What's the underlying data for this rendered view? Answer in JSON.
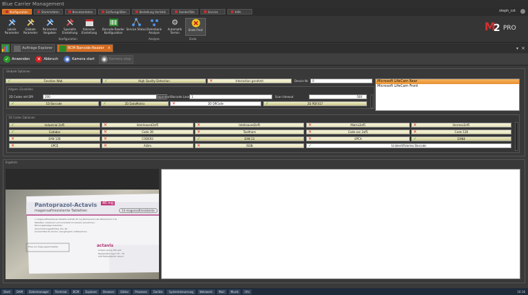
{
  "app": {
    "title": "Blue Carrier Management"
  },
  "ribbon_tabs": [
    {
      "label": "Konfiguration",
      "active": true
    },
    {
      "label": "Stammdaten",
      "active": false
    },
    {
      "label": "Benutzerdaten",
      "active": false
    },
    {
      "label": "Einflussgrößen",
      "active": false
    },
    {
      "label": "Bestellung Vorlistik",
      "active": false
    },
    {
      "label": "Sonderfälle",
      "active": false
    },
    {
      "label": "Service",
      "active": false
    },
    {
      "label": "Hilfe",
      "active": false
    }
  ],
  "user": {
    "name": "steph_cst"
  },
  "ribbon": {
    "buttons": [
      {
        "label": "Lokale Parameter",
        "icon": "tools-icon"
      },
      {
        "label": "Globale Parameter",
        "icon": "tools-icon"
      },
      {
        "label": "Parameter Vorgaben",
        "icon": "tools-icon"
      },
      {
        "label": "Spezielle Einstellung",
        "icon": "tools-icon"
      },
      {
        "label": "Kalender Einstellung",
        "icon": "calendar-icon"
      },
      {
        "label": "Barcode-Reader Konfiguration",
        "icon": "barcode-icon"
      },
      {
        "label": "Service Status",
        "icon": "network-icon"
      },
      {
        "label": "Datenbank Analyse",
        "icon": "database-icon"
      },
      {
        "label": "Automatik Termin",
        "icon": "gear-icon"
      },
      {
        "label": "Ende Prod",
        "icon": "close-icon"
      }
    ],
    "groups": [
      {
        "label": "Konfiguration"
      },
      {
        "label": "Analyse"
      },
      {
        "label": "Ende"
      }
    ]
  },
  "logo": {
    "text": "2",
    "suffix": "PRO"
  },
  "doc_tabs": [
    {
      "label": "Aufträge Explorer",
      "active": false
    },
    {
      "label": "BCM Barcode-Reader",
      "active": true
    }
  ],
  "toolbar": {
    "apply": "Anwenden",
    "cancel": "Abbruch",
    "camera_start": "Kamera start",
    "camera_stop": "Kamera stop"
  },
  "global_options": {
    "title": "Globale Optionen",
    "options": [
      {
        "label": "Function Wab",
        "checked": true
      },
      {
        "label": "High Quality Detection",
        "checked": true
      },
      {
        "label": "Interaction gerahmt",
        "checked": false
      }
    ],
    "device_label": "Device Nr.",
    "device_value": "0"
  },
  "camera_list": {
    "items": [
      {
        "label": "Microsoft LifeCam Rear",
        "selected": true
      },
      {
        "label": "Microsoft LifeCam Front",
        "selected": false
      }
    ]
  },
  "general_settings": {
    "title": "Allgem. Einstellen",
    "dpi_label": "2D Codes mit DPI",
    "dpi_value": "200",
    "separator_label": "Separator/Barcode Laserl",
    "separator_value": "1",
    "timeout_label": "Scan timeout",
    "timeout_value": "500",
    "codes": [
      {
        "label": "1D Barcode",
        "checked": true
      },
      {
        "label": "2D DataMatrix",
        "checked": true
      },
      {
        "label": "2D QRCode",
        "checked": false
      },
      {
        "label": "2D PDF417",
        "checked": true
      }
    ]
  },
  "code_options": {
    "title": "1D Codes Optionen",
    "items": [
      {
        "label": "Industrial 2of5",
        "checked": true
      },
      {
        "label": "Interleaved2of5",
        "checked": false
      },
      {
        "label": "Intelleaved2of5",
        "checked": false
      },
      {
        "label": "Matrix2of5",
        "checked": false
      },
      {
        "label": "Hermes2of5",
        "checked": false
      },
      {
        "label": "Codabar",
        "checked": true
      },
      {
        "label": "Code 39",
        "checked": false
      },
      {
        "label": "Tooltham",
        "checked": false
      },
      {
        "label": "Code sec 2of5",
        "checked": false
      },
      {
        "label": "Code 128",
        "checked": false
      },
      {
        "label": "EAN 128",
        "checked": false
      },
      {
        "label": "CODE93",
        "checked": false
      },
      {
        "label": "EAN 13",
        "checked": true
      },
      {
        "label": "UPCA",
        "checked": false
      },
      {
        "label": "EAN8",
        "checked": true
      },
      {
        "label": "UPCE",
        "checked": false
      },
      {
        "label": "Aiilim",
        "checked": false
      },
      {
        "label": "ISSN",
        "checked": false
      },
      {
        "label": "Unidentifiziertes Barcode",
        "checked": true
      }
    ]
  },
  "results": {
    "title": "Ergebnis"
  },
  "preview": {
    "brand": "Pantoprazol-Actavis",
    "dose": "40 mg",
    "subtitle": "magensaftresistente Tabletten",
    "count": "14 magensaftresistente",
    "lines": [
      "1 magensaftresistente Tablette enthält 40 mg Pantoprazol (als Pantoprazol 1,5)",
      "Tabletten unzerkaut und unzerteilt im Ganzen einnehmen.",
      "Packungsbeilage beachten.",
      "Verschreibungspflichtig. Zul.-Nr. :",
      "Arzneimittel für Kinder unzugänglich aufbewahren."
    ],
    "company": "actavis",
    "address": [
      "Actavis Group PTC ehf.",
      "Reykjavíkurvegur 76 - 78",
      "220 Hafnarfjörður Island"
    ],
    "note": "Eine von Ärgie gesammelten"
  },
  "taskbar": {
    "items": [
      "Start",
      "DAM",
      "Dateimanager",
      "Terminal",
      "BCM",
      "Explorer",
      "Browser",
      "Editor",
      "Prozesse",
      "Geräte",
      "Systemsteuerung",
      "Netzwerk",
      "Mail",
      "Musik",
      "Uhr"
    ],
    "time": "16:16"
  },
  "colors": {
    "accent": "#d46b1f",
    "check": "#2a9a2a",
    "cross": "#e02020"
  }
}
